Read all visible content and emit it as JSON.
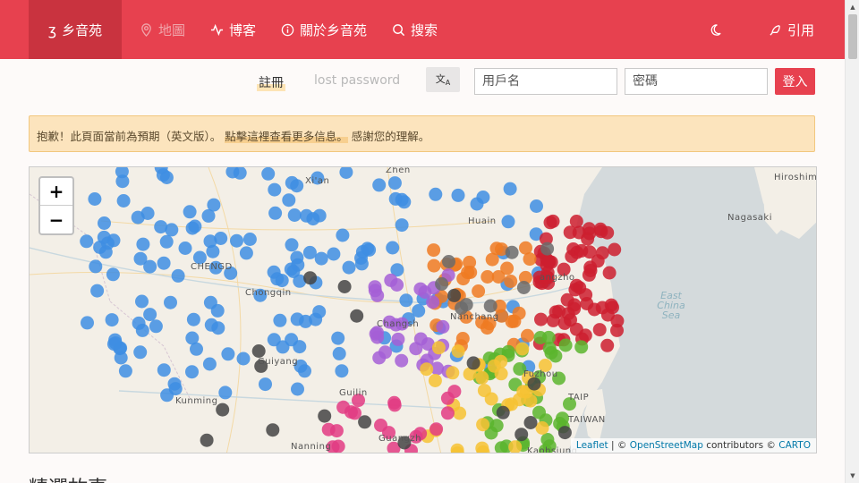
{
  "nav": {
    "brand_label": "乡音苑",
    "map_label": "地圖",
    "blog_label": "博客",
    "about_label": "關於乡音苑",
    "search_label": "搜索",
    "cite_label": "引用"
  },
  "login": {
    "register_label": "註冊",
    "lost_password_label": "lost password",
    "language_icon": "translate-icon",
    "username_placeholder": "用戶名",
    "password_placeholder": "密碼",
    "login_button": "登入"
  },
  "alert": {
    "text_before": "抱歉！此頁面當前為預期（英文版）。",
    "link_text": "點擊這裡查看更多信息。",
    "text_after": "感謝您的理解。"
  },
  "map": {
    "zoom_in": "+",
    "zoom_out": "−",
    "labels": {
      "chengdu": "CHENGD",
      "chongqing": "Chongqin",
      "nanchang": "Nanchang",
      "guiyang": "Guiyang",
      "kunming": "Kunming",
      "guilin": "Guilin",
      "nanning": "Nanning",
      "guangzhou": "Guangzh",
      "fuzhou": "Fuzhou",
      "taipei": "TAIP",
      "taiwan": "TAIWAN",
      "kaohsiung": "Kaohsiung",
      "nagasaki": "Nagasaki",
      "hiroshima": "Hiroshim",
      "huainan": "Huain",
      "xian": "Xi'an",
      "zhengzhou": "Zhen",
      "east_china_sea": "East China Sea",
      "hangzhou": "angzho",
      "changsha": "Changsh"
    },
    "attribution": {
      "leaflet": "Leaflet",
      "separator": "| ©",
      "osm": "OpenStreetMap",
      "contributors": "contributors ©",
      "carto": "CARTO"
    },
    "colors": {
      "blue": "#3e8ee3",
      "red": "#cc1f2f",
      "orange": "#ee7a22",
      "purple": "#a55fd6",
      "green": "#5ab52d",
      "yellow": "#f6c232",
      "pink": "#e23b82",
      "dark": "#444444",
      "gray": "#6b6b6b"
    }
  },
  "section_heading": "精選故事"
}
